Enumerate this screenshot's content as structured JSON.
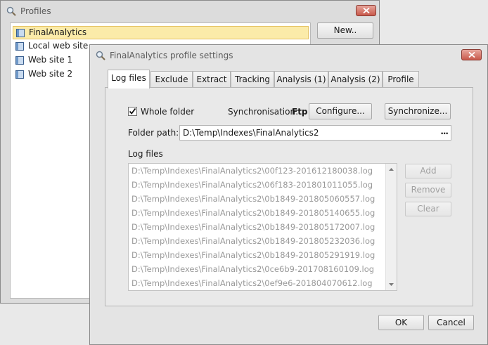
{
  "profiles_window": {
    "title": "Profiles",
    "new_button": "New..",
    "items": [
      {
        "label": "FinalAnalytics",
        "selected": true
      },
      {
        "label": "Local web site",
        "selected": false
      },
      {
        "label": "Web site 1",
        "selected": false
      },
      {
        "label": "Web site 2",
        "selected": false
      }
    ]
  },
  "settings_window": {
    "title": "FinalAnalytics profile settings",
    "tabs": [
      {
        "label": "Log files",
        "active": true
      },
      {
        "label": "Exclude",
        "active": false
      },
      {
        "label": "Extract",
        "active": false
      },
      {
        "label": "Tracking",
        "active": false
      },
      {
        "label": "Analysis (1)",
        "active": false
      },
      {
        "label": "Analysis (2)",
        "active": false
      },
      {
        "label": "Profile",
        "active": false
      }
    ],
    "whole_folder": {
      "label": "Whole folder",
      "checked": true
    },
    "sync_label": "Synchronisation:",
    "sync_value": "Ftp",
    "configure_button": "Configure...",
    "synchronize_button": "Synchronize...",
    "folder_path_label": "Folder path:",
    "folder_path_value": "D:\\Temp\\Indexes\\FinalAnalytics2",
    "browse_button": "...",
    "log_files_label": "Log files",
    "log_files": [
      "D:\\Temp\\Indexes\\FinalAnalytics2\\00f123-201612180038.log",
      "D:\\Temp\\Indexes\\FinalAnalytics2\\06f183-201801011055.log",
      "D:\\Temp\\Indexes\\FinalAnalytics2\\0b1849-201805060557.log",
      "D:\\Temp\\Indexes\\FinalAnalytics2\\0b1849-201805140655.log",
      "D:\\Temp\\Indexes\\FinalAnalytics2\\0b1849-201805172007.log",
      "D:\\Temp\\Indexes\\FinalAnalytics2\\0b1849-201805232036.log",
      "D:\\Temp\\Indexes\\FinalAnalytics2\\0b1849-201805291919.log",
      "D:\\Temp\\Indexes\\FinalAnalytics2\\0ce6b9-201708160109.log",
      "D:\\Temp\\Indexes\\FinalAnalytics2\\0ef9e6-201804070612.log"
    ],
    "add_button": "Add",
    "remove_button": "Remove",
    "clear_button": "Clear",
    "ok_button": "OK",
    "cancel_button": "Cancel"
  },
  "colors": {
    "selection_bg": "#fbeba9",
    "close_button": "#c9594b",
    "disabled_text": "#9a9a9a"
  }
}
